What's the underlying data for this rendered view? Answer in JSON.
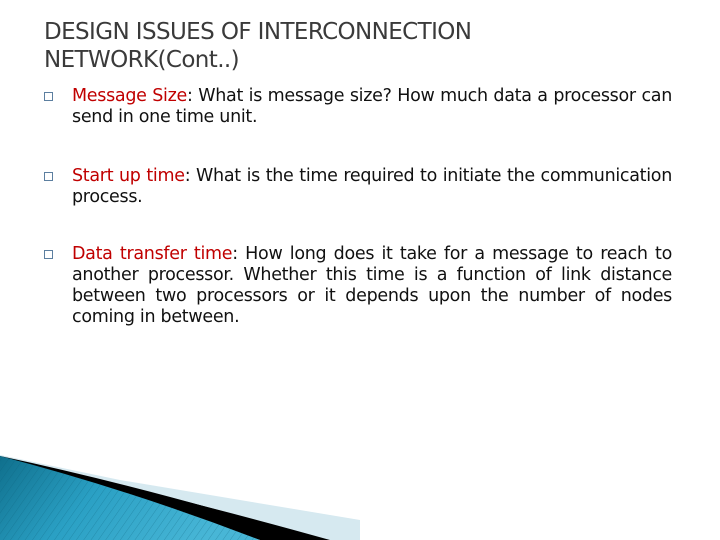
{
  "slide": {
    "title_lines": [
      "DESIGN ISSUES OF INTERCONNECTION",
      "NETWORK(Cont..)"
    ],
    "bullets": [
      {
        "icon": "square-bullet-icon",
        "term": "Message Size",
        "separator": ":",
        "text": " What is message size? How much data a processor can send in one time unit."
      },
      {
        "icon": "square-bullet-icon",
        "term": "Start up time",
        "separator": ":",
        "text": " What is the time required to initiate the communication process."
      },
      {
        "icon": "square-bullet-icon",
        "term": "Data transfer time",
        "separator": ":",
        "text": " How long does it take for a message to reach to another processor. Whether this time is a function of link distance between two processors or it depends upon the number of nodes coming in between."
      }
    ],
    "colors": {
      "title": "#3a3a3a",
      "term": "#c00000",
      "body": "#111111",
      "accent_teal": "#1e8fb0",
      "accent_light": "#d6e9f0"
    }
  }
}
